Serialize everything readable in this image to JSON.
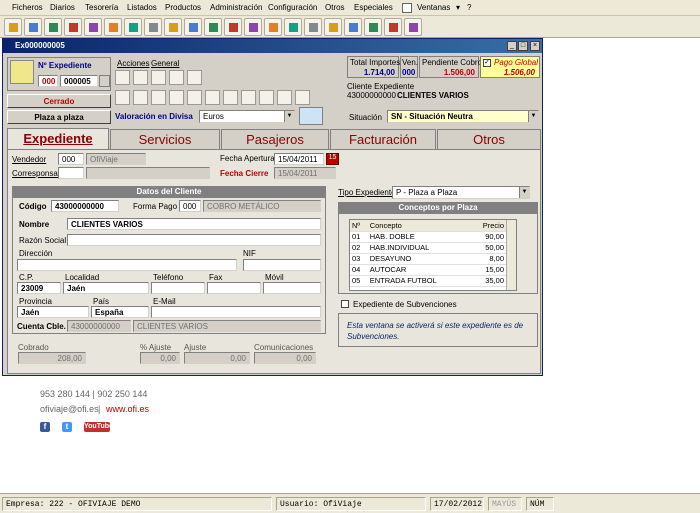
{
  "menu": [
    "Ficheros",
    "Diarios",
    "Tesorería",
    "Listados",
    "Productos",
    "Administración",
    "Configuración",
    "Otros",
    "Especiales",
    "Ventanas",
    "?"
  ],
  "toolbar_icons": [
    "exit-icon",
    "print-icon",
    "calculator-icon",
    "tickets-icon",
    "magnify-icon",
    "hotel-icon",
    "customers-icon",
    "invoice-icon",
    "bank-icon",
    "calendar-icon",
    "agenda-icon",
    "form-icon",
    "travel-icon",
    "bus-icon",
    "scissors-icon",
    "contacts-icon",
    "warning-icon",
    "lock-icon",
    "note-icon",
    "camera-icon",
    "money-icon"
  ],
  "window": {
    "title": "Ex000000005"
  },
  "exp": {
    "label": "Nº Expediente",
    "serie": "000",
    "numero": "000005",
    "estado": "Cerrado",
    "tipo_btn": "Plaza a plaza"
  },
  "acciones": {
    "acciones": "Acciones",
    "general": "General"
  },
  "totales": {
    "total_importes_label": "Total Importes",
    "total_importes": "1.714,00",
    "ven_label": "Ven.",
    "ven": "000",
    "pendiente_label": "Pendiente Cobro",
    "pendiente": "1.506,00",
    "pago_global_label": "Pago Global",
    "pago_global": "1.506,00"
  },
  "cliente_exp": {
    "label": "Cliente Expediente",
    "codigo": "43000000000",
    "nombre": "CLIENTES VARIOS"
  },
  "valoracion": {
    "label": "Valoración en Divisa",
    "value": "Euros"
  },
  "situacion": {
    "label": "Situación",
    "value": "SN - Situación Neutra"
  },
  "tabs": [
    "Expediente",
    "Servicios",
    "Pasajeros",
    "Facturación",
    "Otros"
  ],
  "top_fields": {
    "vendedor_label": "Vendedor",
    "vendedor": "000",
    "vendedor_nombre": "OfiViaje",
    "corresponsal_label": "Corresponsal",
    "fecha_apertura_label": "Fecha Apertura",
    "fecha_apertura": "15/04/2011",
    "fecha_cierre_label": "Fecha Cierre",
    "fecha_cierre": "15/04/2011"
  },
  "datos": {
    "title": "Datos del Cliente",
    "codigo_label": "Código",
    "codigo": "43000000000",
    "forma_pago_label": "Forma Pago",
    "forma_pago": "000",
    "forma_pago_desc": "COBRO METÁLICO",
    "nombre_label": "Nombre",
    "nombre": "CLIENTES VARIOS",
    "razon_label": "Razón Social",
    "razon": "",
    "direccion_label": "Dirección",
    "nif_label": "NIF",
    "cp_label": "C.P.",
    "cp": "23009",
    "localidad_label": "Localidad",
    "localidad": "Jaén",
    "telefono_label": "Teléfono",
    "fax_label": "Fax",
    "movil_label": "Móvil",
    "provincia_label": "Provincia",
    "provincia": "Jaén",
    "pais_label": "País",
    "pais": "España",
    "email_label": "E-Mail",
    "cuenta_label": "Cuenta Cble.",
    "cuenta": "43000000000",
    "cuenta_desc": "CLIENTES VARIOS"
  },
  "tipo_exp": {
    "label": "Tipo Expediente",
    "value": "P - Plaza a Plaza"
  },
  "conceptos": {
    "title": "Conceptos por Plaza",
    "headers": [
      "Nº",
      "Concepto",
      "Precio"
    ],
    "rows": [
      [
        "01",
        "HAB. DOBLE",
        "90,00"
      ],
      [
        "02",
        "HAB.INDIVIDUAL",
        "50,00"
      ],
      [
        "03",
        "DESAYUNO",
        "8,00"
      ],
      [
        "04",
        "AUTOCAR",
        "15,00"
      ],
      [
        "05",
        "ENTRADA FUTBOL",
        "35,00"
      ]
    ]
  },
  "subvenciones": {
    "label": "Expediente de Subvenciones",
    "note": "Esta ventana se activerá si este expediente es de Subvenciones."
  },
  "bottom": {
    "cobrado_label": "Cobrado",
    "cobrado": "208,00",
    "pct_label": "% Ajuste",
    "pct": "0,00",
    "ajuste_label": "Ajuste",
    "ajuste": "0,00",
    "com_label": "Comunicaciones",
    "com": "0,00"
  },
  "footer": {
    "phones": "953 280 144  |  902 250 144",
    "email": "ofiviaje@ofi.es",
    "web": "www.ofi.es",
    "youtube": "YouTube"
  },
  "status": {
    "empresa": "Empresa: 222 - OFIVIAJE DEMO",
    "usuario": "Usuario: OfiViaje",
    "fecha": "17/02/2012",
    "mayus": "MAYÚS",
    "num": "NÚM"
  },
  "colors": {
    "title_bar": "#0a246a",
    "accent_red": "#c00000",
    "tab_text": "#8b0000"
  }
}
